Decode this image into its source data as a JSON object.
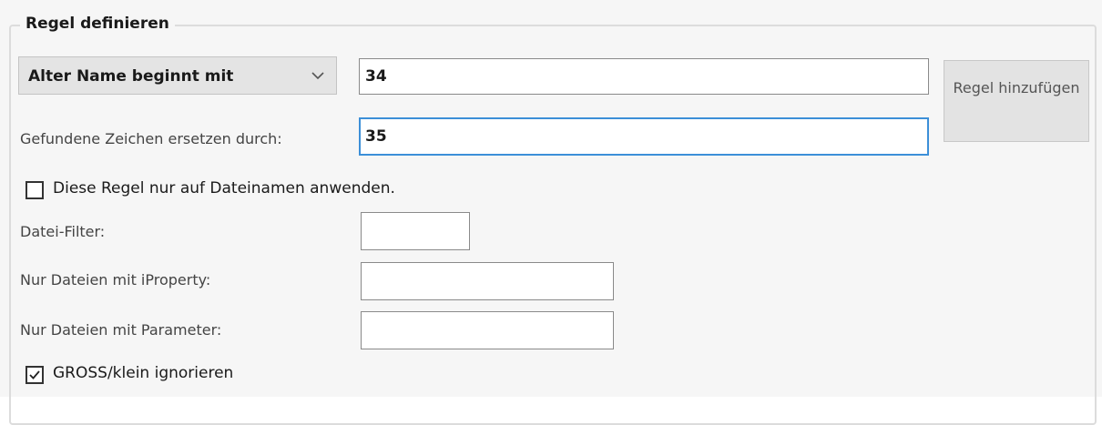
{
  "group": {
    "title": "Regel definieren"
  },
  "rule": {
    "type_selected": "Alter Name beginnt mit",
    "search_value": "34",
    "replace_label": "Gefundene Zeichen ersetzen durch:",
    "replace_value": "35",
    "add_button_label": "Regel hinzufügen"
  },
  "options": {
    "filename_only_label": "Diese Regel nur auf Dateinamen anwenden.",
    "filename_only_checked": false,
    "file_filter_label": "Datei-Filter:",
    "file_filter_value": "",
    "iproperty_label": "Nur Dateien mit iProperty:",
    "iproperty_value": "",
    "parameter_label": "Nur Dateien mit Parameter:",
    "parameter_value": "",
    "ignore_case_label": "GROSS/klein ignorieren",
    "ignore_case_checked": true
  },
  "icons": {
    "combo_chevron": "chevron-down-icon",
    "checkmark": "checkmark-icon"
  },
  "colors": {
    "focus_border": "#3c8fd8",
    "panel_background": "#f6f6f6"
  }
}
